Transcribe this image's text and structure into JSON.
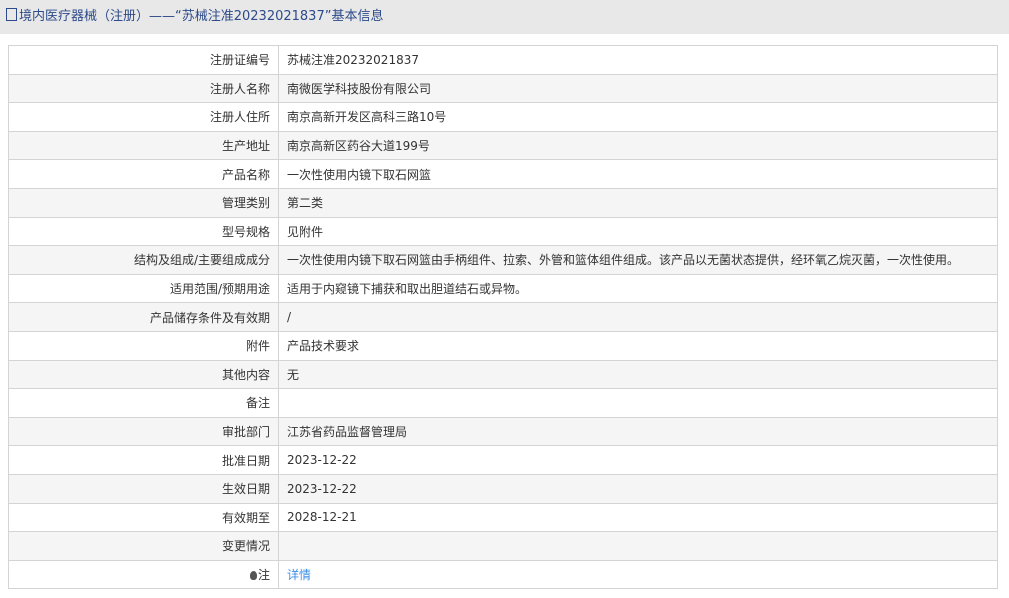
{
  "title": "境内医疗器械（注册）——“苏械注准20232021837”基本信息",
  "rows": [
    {
      "label": "注册证编号",
      "value": "苏械注准20232021837"
    },
    {
      "label": "注册人名称",
      "value": "南微医学科技股份有限公司"
    },
    {
      "label": "注册人住所",
      "value": "南京高新开发区高科三路10号"
    },
    {
      "label": "生产地址",
      "value": "南京高新区药谷大道199号"
    },
    {
      "label": "产品名称",
      "value": "一次性使用内镜下取石网篮"
    },
    {
      "label": "管理类别",
      "value": "第二类"
    },
    {
      "label": "型号规格",
      "value": "见附件"
    },
    {
      "label": "结构及组成/主要组成成分",
      "value": "一次性使用内镜下取石网篮由手柄组件、拉索、外管和篮体组件组成。该产品以无菌状态提供，经环氧乙烷灭菌，一次性使用。"
    },
    {
      "label": "适用范围/预期用途",
      "value": "适用于内窥镜下捕获和取出胆道结石或异物。"
    },
    {
      "label": "产品储存条件及有效期",
      "value": "/"
    },
    {
      "label": "附件",
      "value": "产品技术要求"
    },
    {
      "label": "其他内容",
      "value": "无"
    },
    {
      "label": "备注",
      "value": ""
    },
    {
      "label": "审批部门",
      "value": "江苏省药品监督管理局"
    },
    {
      "label": "批准日期",
      "value": "2023-12-22"
    },
    {
      "label": "生效日期",
      "value": "2023-12-22"
    },
    {
      "label": "有效期至",
      "value": "2028-12-21"
    },
    {
      "label": "变更情况",
      "value": ""
    }
  ],
  "note": {
    "label": "注",
    "link": "详情"
  }
}
